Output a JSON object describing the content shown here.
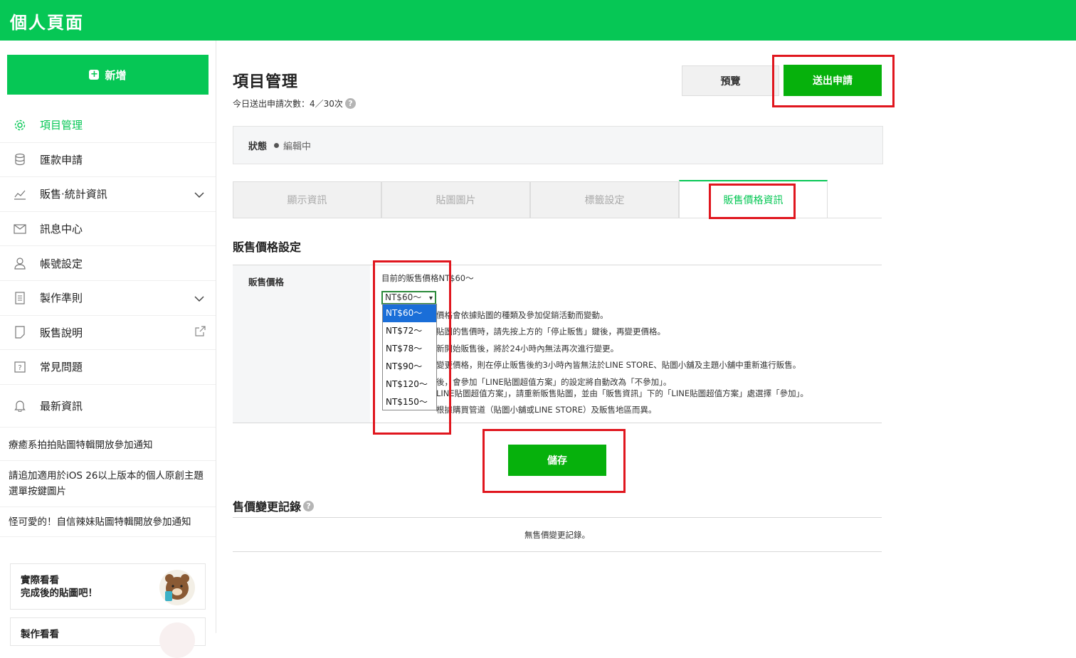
{
  "header": {
    "title": "個人頁面"
  },
  "sidebar": {
    "new_label": "新增",
    "items": [
      {
        "label": "項目管理",
        "icon": "gear-icon",
        "active": true
      },
      {
        "label": "匯款申請",
        "icon": "database-icon"
      },
      {
        "label": "販售‧統計資訊",
        "icon": "chart-icon",
        "expandable": true
      },
      {
        "label": "訊息中心",
        "icon": "mail-icon"
      },
      {
        "label": "帳號設定",
        "icon": "user-icon"
      },
      {
        "label": "製作準則",
        "icon": "document-icon",
        "expandable": true
      },
      {
        "label": "販售說明",
        "icon": "note-icon",
        "external": true
      },
      {
        "label": "常見問題",
        "icon": "question-icon"
      },
      {
        "label": "最新資訊",
        "icon": "bell-icon"
      }
    ],
    "news": [
      "療癒系拍拍貼圖特輯開放參加通知",
      "請追加適用於iOS 26以上版本的個人原創主題選單按鍵圖片",
      "怪可愛的！自信辣妹貼圖特輯開放參加通知"
    ],
    "promos": [
      {
        "text": "實際看看\n完成後的貼圖吧！"
      },
      {
        "text": "製作看看"
      }
    ]
  },
  "main": {
    "title": "項目管理",
    "counter": "今日送出申請次數：4／30次",
    "preview_label": "預覽",
    "submit_label": "送出申請",
    "status_label": "狀態",
    "status_value": "編輯中",
    "tabs": [
      "顯示資訊",
      "貼圖圖片",
      "標籤設定",
      "販售價格資訊"
    ],
    "active_tab": 3,
    "section_title": "販售價格設定",
    "price_label": "販售價格",
    "current_price": "目前的販售價格NT$60～",
    "selected_price": "NT$60～",
    "price_options": [
      "NT$60～",
      "NT$72～",
      "NT$78～",
      "NT$90～",
      "NT$120～",
      "NT$150～"
    ],
    "notes": [
      "價格會依據貼圖的種類及參加促銷活動而變動。",
      "貼圖的售價時，請先按上方的「停止販售」鍵後，再變更價格。",
      "新開始販售後，將於24小時內無法再次進行變更。",
      "變更價格，則在停止販售後約3小時內皆無法於LINE STORE、貼圖小舖及主題小舖中重新進行販售。",
      "後，會參加「LINE貼圖超值方案」的設定將自動改為「不參加」。",
      "LINE貼圖超值方案」，請重新販售貼圖，並由「販售資訊」下的「LINE貼圖超值方案」處選擇「參加」。",
      "根據購買管道（貼圖小舖或LINE STORE）及販售地區而異。"
    ],
    "save_label": "儲存",
    "history_title": "售價變更記錄",
    "history_empty": "無售價變更記錄。"
  }
}
